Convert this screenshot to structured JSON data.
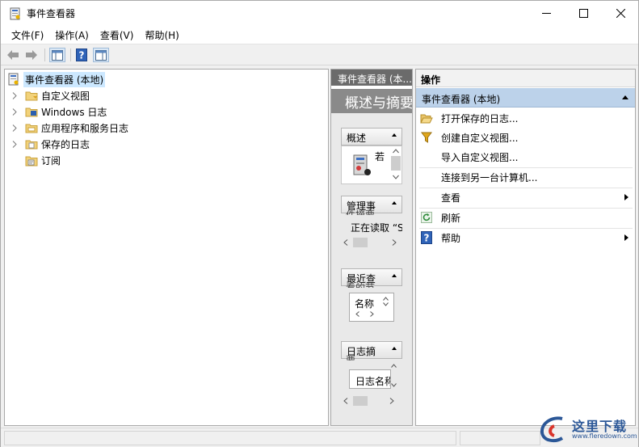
{
  "window": {
    "title": "事件查看器",
    "colors": {
      "tree_selection": "#cce8ff",
      "actions_group": "#bcd2ea",
      "center_header": "#6b6b6b"
    }
  },
  "menu": [
    "文件(F)",
    "操作(A)",
    "查看(V)",
    "帮助(H)"
  ],
  "toolbar": {
    "icons": [
      "back-arrow-icon",
      "forward-arrow-icon",
      "show-hide-tree-icon",
      "help-icon",
      "show-hide-action-pane-icon"
    ]
  },
  "tree": {
    "root": "事件查看器 (本地)",
    "items": [
      "自定义视图",
      "Windows 日志",
      "应用程序和服务日志",
      "保存的日志",
      "订阅"
    ]
  },
  "center": {
    "header": "事件查看器 (本...",
    "banner": "概述与摘要",
    "overview": {
      "title": "概述",
      "text": "若"
    },
    "admin": {
      "title": "管理事",
      "title_cont": "件摘要",
      "text": "正在读取 “S"
    },
    "recent": {
      "title": "最近查",
      "title_cont": "看的节",
      "column": "名称"
    },
    "logsummary": {
      "title": "日志摘",
      "title_cont": "要",
      "column": "日志名称"
    }
  },
  "actions": {
    "header": "操作",
    "group": "事件查看器 (本地)",
    "items": [
      {
        "label": "打开保存的日志...",
        "icon": "folder-open-icon"
      },
      {
        "label": "创建自定义视图...",
        "icon": "filter-icon"
      },
      {
        "label": "导入自定义视图...",
        "icon": ""
      },
      {
        "label": "连接到另一台计算机...",
        "icon": ""
      },
      {
        "label": "查看",
        "icon": ""
      },
      {
        "label": "刷新",
        "icon": "refresh-icon"
      },
      {
        "label": "帮助",
        "icon": "help-icon"
      }
    ]
  },
  "watermark": {
    "text": "这里下载",
    "url": "www.fleredown.com"
  }
}
